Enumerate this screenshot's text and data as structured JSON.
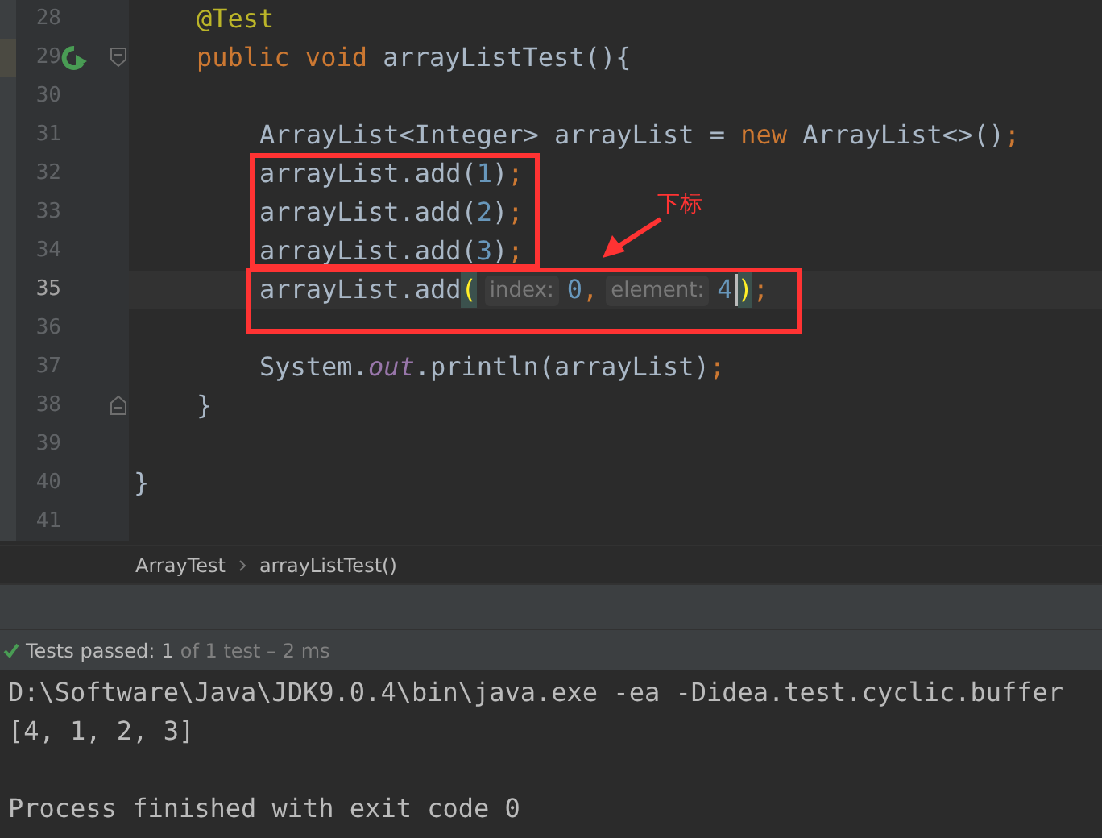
{
  "editor": {
    "lines": [
      {
        "number": "28",
        "current": false,
        "kind": "member",
        "tokens": [
          {
            "kind": "annotation",
            "text": "@Test"
          }
        ]
      },
      {
        "number": "29",
        "current": false,
        "run_marker": true,
        "fold_start": true,
        "kind": "member",
        "tokens": [
          {
            "kind": "keyword",
            "text": "public void "
          },
          {
            "kind": "plain",
            "text": "arrayListTest(){"
          }
        ]
      },
      {
        "number": "30",
        "current": false,
        "kind": "blank"
      },
      {
        "number": "31",
        "current": false,
        "kind": "statement",
        "tokens": [
          {
            "kind": "plain",
            "text": "ArrayList<Integer> arrayList = "
          },
          {
            "kind": "keyword",
            "text": "new "
          },
          {
            "kind": "plain",
            "text": "ArrayList<>()"
          },
          {
            "kind": "keyword",
            "text": ";"
          }
        ]
      },
      {
        "number": "32",
        "current": false,
        "kind": "statement",
        "tokens": [
          {
            "kind": "plain",
            "text": "arrayList.add("
          },
          {
            "kind": "number",
            "text": "1"
          },
          {
            "kind": "plain",
            "text": ")"
          },
          {
            "kind": "keyword",
            "text": ";"
          }
        ]
      },
      {
        "number": "33",
        "current": false,
        "kind": "statement",
        "tokens": [
          {
            "kind": "plain",
            "text": "arrayList.add("
          },
          {
            "kind": "number",
            "text": "2"
          },
          {
            "kind": "plain",
            "text": ")"
          },
          {
            "kind": "keyword",
            "text": ";"
          }
        ]
      },
      {
        "number": "34",
        "current": false,
        "kind": "statement",
        "tokens": [
          {
            "kind": "plain",
            "text": "arrayList.add("
          },
          {
            "kind": "number",
            "text": "3"
          },
          {
            "kind": "plain",
            "text": ")"
          },
          {
            "kind": "keyword",
            "text": ";"
          }
        ]
      },
      {
        "number": "35",
        "current": true,
        "kind": "statement",
        "tokens": [
          {
            "kind": "plain",
            "text": "arrayList.add"
          },
          {
            "kind": "brace",
            "text": "("
          },
          {
            "kind": "hint",
            "text": "index:"
          },
          {
            "kind": "number",
            "text": "0"
          },
          {
            "kind": "keyword",
            "text": ","
          },
          {
            "kind": "hint",
            "text": "element:"
          },
          {
            "kind": "number",
            "text": "4",
            "caret": true
          },
          {
            "kind": "brace",
            "text": ")"
          },
          {
            "kind": "keyword",
            "text": ";"
          }
        ]
      },
      {
        "number": "36",
        "current": false,
        "kind": "blank"
      },
      {
        "number": "37",
        "current": false,
        "kind": "statement",
        "tokens": [
          {
            "kind": "plain",
            "text": "System."
          },
          {
            "kind": "field",
            "text": "out"
          },
          {
            "kind": "plain",
            "text": ".println(arrayList)"
          },
          {
            "kind": "keyword",
            "text": ";"
          }
        ]
      },
      {
        "number": "38",
        "current": false,
        "fold_end": true,
        "kind": "member",
        "tokens": [
          {
            "kind": "plain",
            "text": "}"
          }
        ]
      },
      {
        "number": "39",
        "current": false,
        "kind": "blank"
      },
      {
        "number": "40",
        "current": false,
        "kind": "class",
        "tokens": [
          {
            "kind": "plain",
            "text": "}"
          }
        ]
      },
      {
        "number": "41",
        "current": false,
        "kind": "blank"
      }
    ],
    "callout": {
      "label": "下标"
    }
  },
  "breadcrumbs": [
    "ArrayTest",
    "arrayListTest()"
  ],
  "test_status": {
    "passed": true,
    "label": "Tests passed:",
    "count": "1",
    "detail": "of 1 test – 2 ms"
  },
  "console": {
    "lines": [
      {
        "text": "D:\\Software\\Java\\JDK9.0.4\\bin\\java.exe -ea -Didea.test.cyclic.buffer"
      },
      {
        "text": "[4, 1, 2, 3]"
      },
      {
        "kind": "blank"
      },
      {
        "text": "Process finished with exit code 0"
      }
    ]
  }
}
